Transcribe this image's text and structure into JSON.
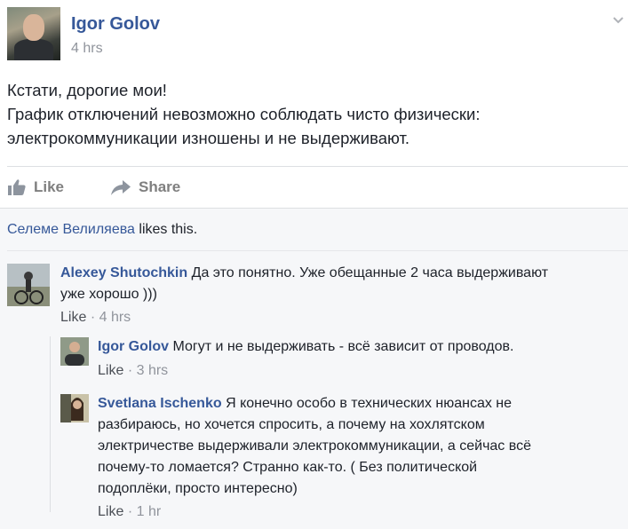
{
  "post": {
    "author": "Igor Golov",
    "time": "4 hrs",
    "lines": [
      "Кстати, дорогие мои!",
      "График отключений невозможно соблюдать чисто физически:",
      "электрокоммуникации изношены и не выдерживают."
    ],
    "menu_icon": "chevron-down-icon"
  },
  "actions": {
    "like_label": "Like",
    "share_label": "Share",
    "like_icon": "thumbs-up-icon",
    "share_icon": "share-arrow-icon"
  },
  "likes_summary": {
    "name": "Селеме Велиляева",
    "suffix": " likes this."
  },
  "comments": [
    {
      "author": "Alexey Shutochkin",
      "lines": [
        "Да это понятно. Уже обещанные 2 часа выдерживают",
        "уже хорошо )))"
      ],
      "like_label": "Like",
      "separator": "·",
      "time": "4 hrs"
    },
    {
      "author": "Igor Golov",
      "lines": [
        "Могут и не выдерживать - всё зависит от проводов."
      ],
      "like_label": "Like",
      "separator": "·",
      "time": "3 hrs"
    },
    {
      "author": "Svetlana Ischenko",
      "lines": [
        "Я конечно особо в технических нюансах не",
        "разбираюсь, но хочется спросить, а почему на хохлятском",
        "электричестве выдерживали электрокоммуникации, а сейчас всё",
        "почему-то ломается? Странно как-то. ( Без политической",
        "подоплёки, просто интересно)"
      ],
      "like_label": "Like",
      "separator": "·",
      "time": "1 hr"
    }
  ],
  "colors": {
    "link": "#365899",
    "meta": "#90949c",
    "text": "#1d2129",
    "comments_bg": "#f6f7f9",
    "divider": "#dddfe2"
  }
}
